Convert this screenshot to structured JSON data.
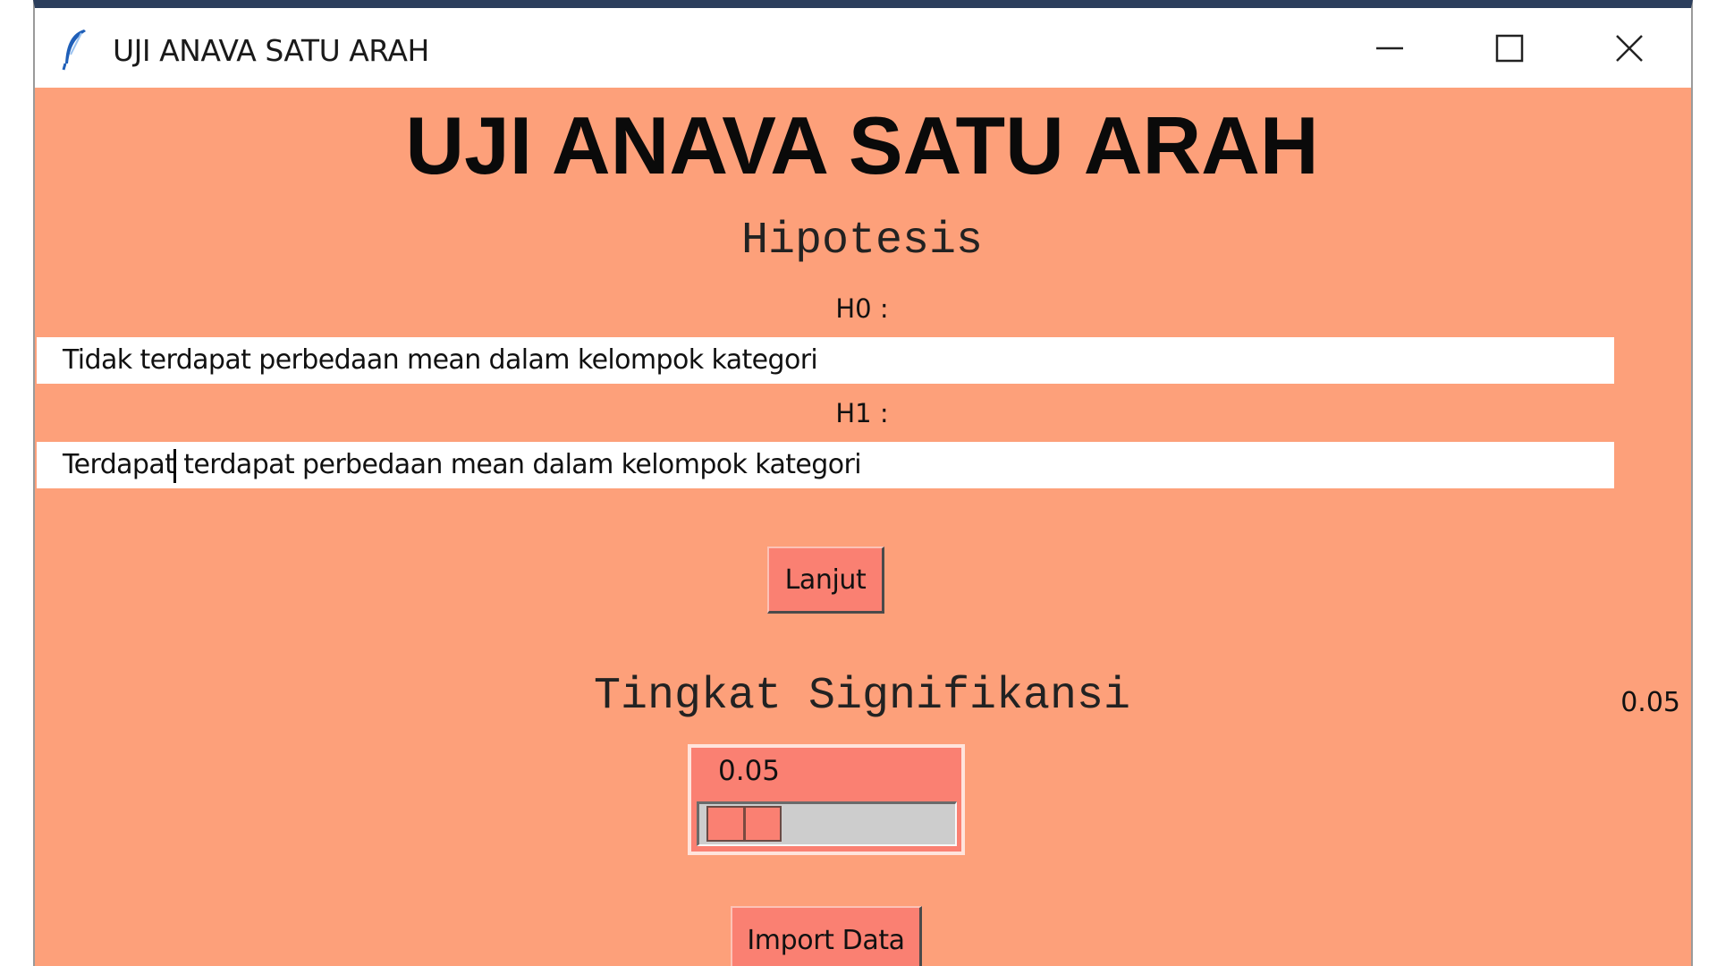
{
  "window": {
    "title": "UJI ANAVA SATU ARAH",
    "controls": [
      "minimize",
      "maximize",
      "close"
    ]
  },
  "main": {
    "heading": "UJI ANAVA SATU ARAH",
    "hypothesis_heading": "Hipotesis",
    "h0_label": "H0 :",
    "h0_value": "Tidak terdapat perbedaan mean dalam kelompok kategori",
    "h1_label": "H1 :",
    "h1_value_before_caret": "Terdapat",
    "h1_value_after_caret": " terdapat perbedaan mean dalam kelompok kategori",
    "next_button": "Lanjut",
    "significance_heading": "Tingkat Signifikansi",
    "significance_scale_value": "0.05",
    "significance_level": 0.05,
    "significance_readout": "0.05",
    "import_button": "Import Data"
  },
  "colors": {
    "background": "#fda07a",
    "button": "#fa8072",
    "titlebar_accent": "#2b3e5c"
  }
}
